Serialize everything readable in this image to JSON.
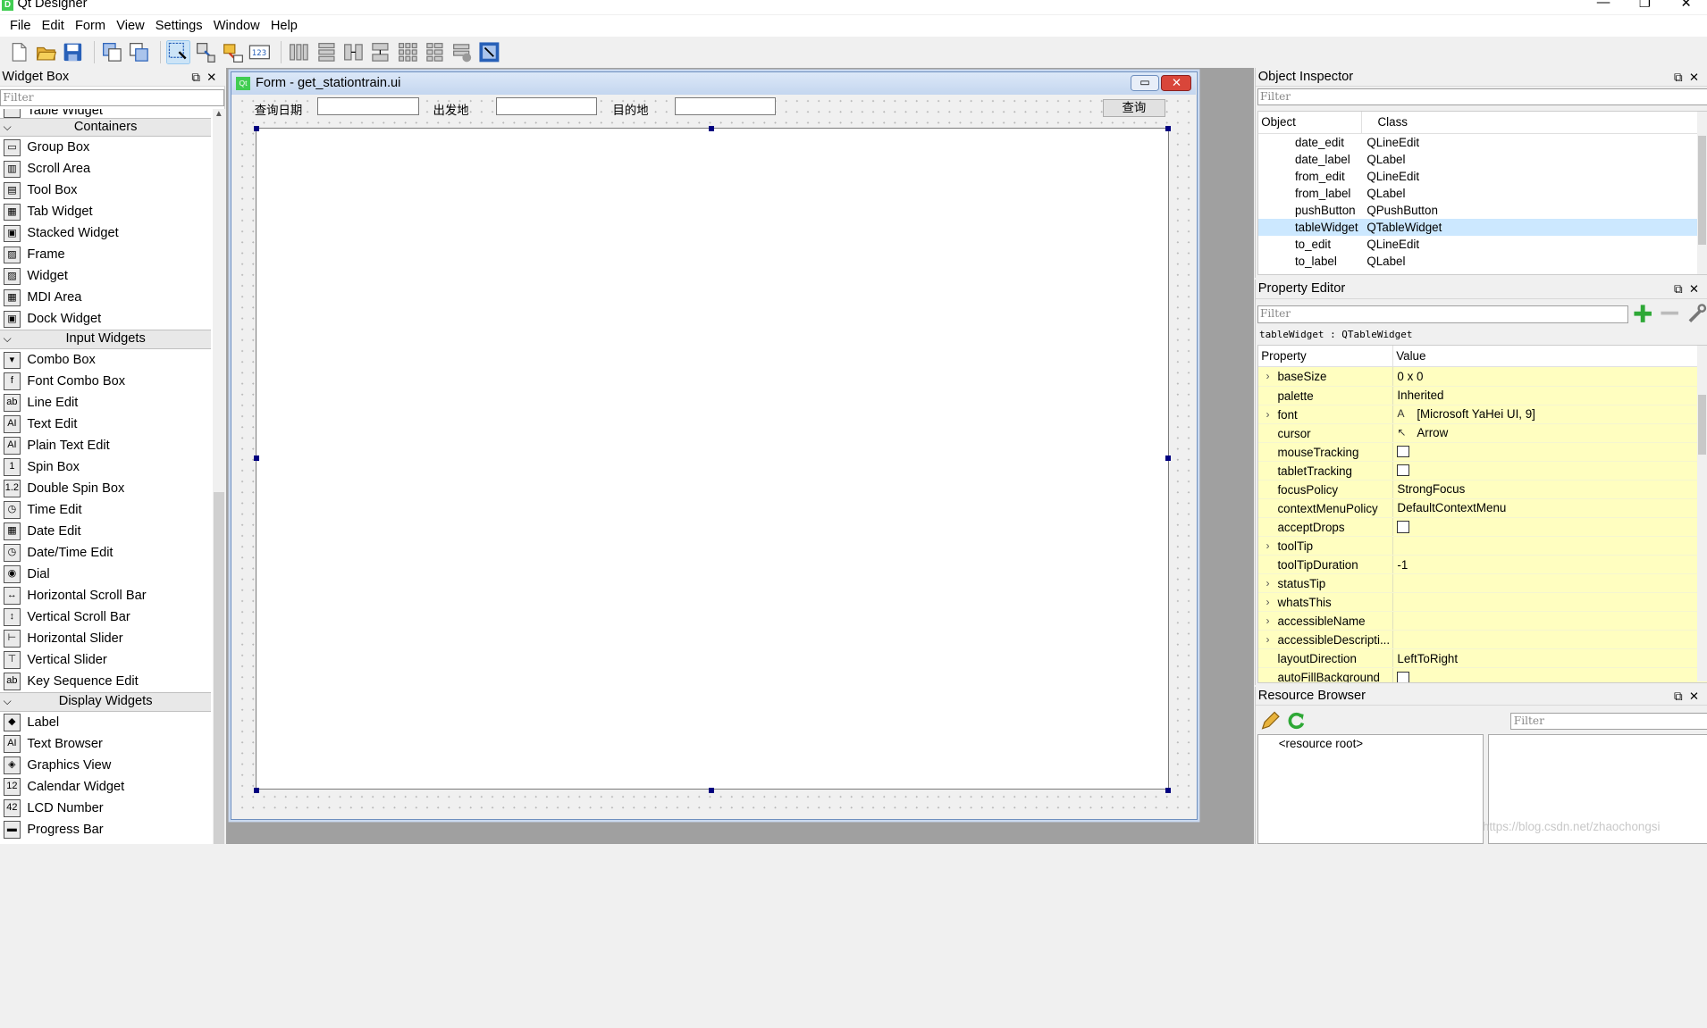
{
  "app": {
    "title": "Qt Designer",
    "logo_text": "D"
  },
  "window_controls": {
    "minimize": "—",
    "restore": "❐",
    "close": "✕"
  },
  "menubar": [
    {
      "key": "F",
      "rest": "ile"
    },
    {
      "key": "E",
      "rest": "dit"
    },
    {
      "key": "F",
      "rest": "orm",
      "prefix": ""
    },
    {
      "key": "V",
      "rest": "iew"
    },
    {
      "key": "S",
      "rest": "ettings"
    },
    {
      "key": "W",
      "rest": "indow"
    },
    {
      "key": "H",
      "rest": "elp"
    }
  ],
  "menu_labels": {
    "file": "File",
    "edit": "Edit",
    "form": "Form",
    "view": "View",
    "settings": "Settings",
    "window": "Window",
    "help": "Help"
  },
  "widget_box": {
    "title": "Widget Box",
    "filter_placeholder": "Filter",
    "partial_item": "Table Widget",
    "categories": [
      {
        "name": "Containers",
        "items": [
          "Group Box",
          "Scroll Area",
          "Tool Box",
          "Tab Widget",
          "Stacked Widget",
          "Frame",
          "Widget",
          "MDI Area",
          "Dock Widget"
        ]
      },
      {
        "name": "Input Widgets",
        "items": [
          "Combo Box",
          "Font Combo Box",
          "Line Edit",
          "Text Edit",
          "Plain Text Edit",
          "Spin Box",
          "Double Spin Box",
          "Time Edit",
          "Date Edit",
          "Date/Time Edit",
          "Dial",
          "Horizontal Scroll Bar",
          "Vertical Scroll Bar",
          "Horizontal Slider",
          "Vertical Slider",
          "Key Sequence Edit"
        ]
      },
      {
        "name": "Display Widgets",
        "items": [
          "Label",
          "Text Browser",
          "Graphics View",
          "Calendar Widget",
          "LCD Number",
          "Progress Bar"
        ]
      }
    ]
  },
  "form": {
    "title": "Form - get_stationtrain.ui",
    "qt_badge": "Qt",
    "date_label": "查询日期",
    "from_label": "出发地",
    "to_label": "目的地",
    "button": "查询"
  },
  "object_inspector": {
    "title": "Object Inspector",
    "filter_placeholder": "Filter",
    "col_object": "Object",
    "col_class": "Class",
    "rows": [
      {
        "object": "date_edit",
        "class": "QLineEdit"
      },
      {
        "object": "date_label",
        "class": "QLabel"
      },
      {
        "object": "from_edit",
        "class": "QLineEdit"
      },
      {
        "object": "from_label",
        "class": "QLabel"
      },
      {
        "object": "pushButton",
        "class": "QPushButton"
      },
      {
        "object": "tableWidget",
        "class": "QTableWidget",
        "selected": true
      },
      {
        "object": "to_edit",
        "class": "QLineEdit"
      },
      {
        "object": "to_label",
        "class": "QLabel"
      }
    ]
  },
  "property_editor": {
    "title": "Property Editor",
    "filter_placeholder": "Filter",
    "object_line": "tableWidget : QTableWidget",
    "col_property": "Property",
    "col_value": "Value",
    "rows": [
      {
        "name": "baseSize",
        "value": "0 x 0",
        "expand": true
      },
      {
        "name": "palette",
        "value": "Inherited"
      },
      {
        "name": "font",
        "value": "[Microsoft YaHei UI, 9]",
        "expand": true,
        "icon": "A"
      },
      {
        "name": "cursor",
        "value": "Arrow",
        "icon": "↖"
      },
      {
        "name": "mouseTracking",
        "value": "",
        "check": true
      },
      {
        "name": "tabletTracking",
        "value": "",
        "check": true
      },
      {
        "name": "focusPolicy",
        "value": "StrongFocus"
      },
      {
        "name": "contextMenuPolicy",
        "value": "DefaultContextMenu"
      },
      {
        "name": "acceptDrops",
        "value": "",
        "check": true
      },
      {
        "name": "toolTip",
        "value": "",
        "expand": true
      },
      {
        "name": "toolTipDuration",
        "value": "-1"
      },
      {
        "name": "statusTip",
        "value": "",
        "expand": true
      },
      {
        "name": "whatsThis",
        "value": "",
        "expand": true
      },
      {
        "name": "accessibleName",
        "value": "",
        "expand": true
      },
      {
        "name": "accessibleDescripti...",
        "value": "",
        "expand": true
      },
      {
        "name": "layoutDirection",
        "value": "LeftToRight"
      },
      {
        "name": "autoFillBackground",
        "value": "",
        "check": true
      }
    ]
  },
  "resource_browser": {
    "title": "Resource Browser",
    "filter_placeholder": "Filter",
    "root": "<resource root>"
  },
  "watermark": "https://blog.csdn.net/zhaochongsi"
}
